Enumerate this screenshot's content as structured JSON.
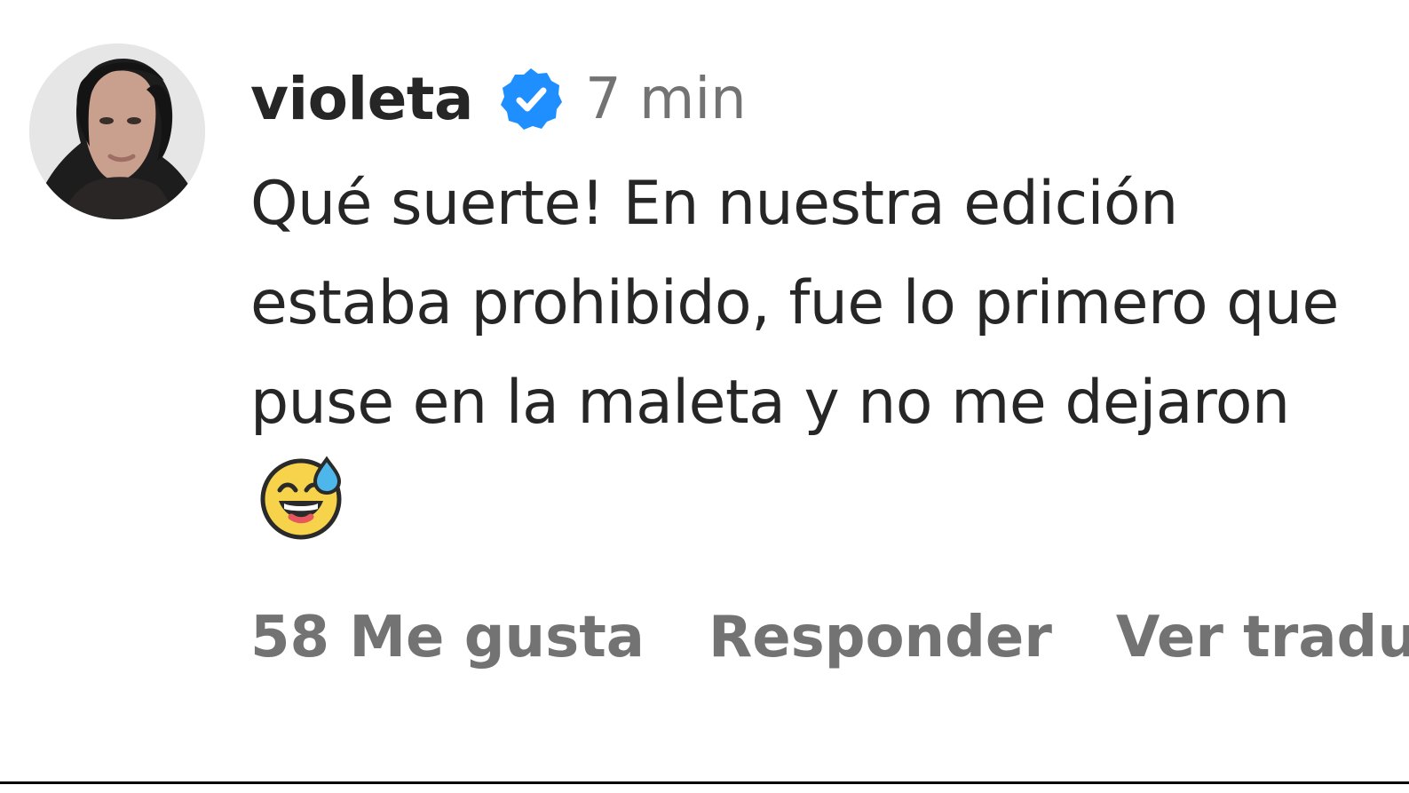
{
  "comment": {
    "username": "violeta",
    "verified_icon": "verified-badge-icon",
    "timestamp": "7 min",
    "text": "Qué suerte! En nuestra edición estaba prohibido, fue lo primero que puse en la maleta y no me dejaron",
    "emoji_icon": "grinning-face-with-sweat-icon",
    "actions": {
      "likes": "58 Me gusta",
      "reply": "Responder",
      "translate": "Ver traducc"
    }
  },
  "colors": {
    "background": "#ffffff",
    "text": "#262626",
    "muted": "#737373",
    "verified": "#1f8fff"
  }
}
